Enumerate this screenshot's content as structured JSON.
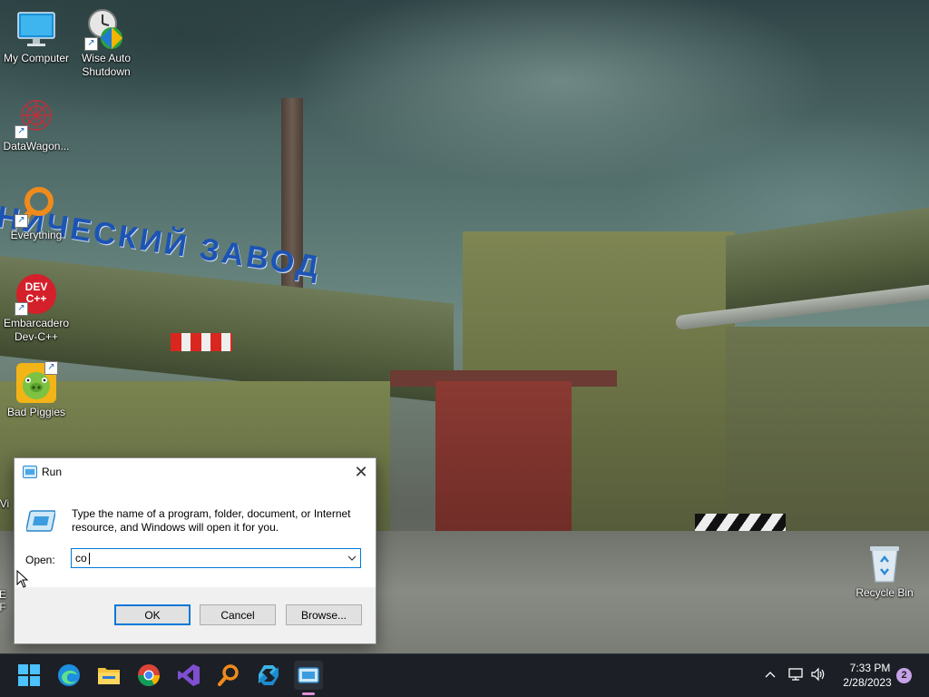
{
  "desktop": {
    "wallpaper_sign_text": "НИЧЕСКИЙ ЗАВОД",
    "icons": [
      {
        "label": "My Computer"
      },
      {
        "label": "Wise Auto Shutdown"
      },
      {
        "label": "DataWagon..."
      },
      {
        "label": "Everything"
      },
      {
        "label": "Embarcadero Dev-C++"
      },
      {
        "label": "Bad Piggies"
      },
      {
        "label": "Recycle Bin"
      }
    ],
    "devcpp_logo_text": "DEV C++",
    "partial_left_labels": [
      "Vi",
      "E",
      "F"
    ]
  },
  "run_dialog": {
    "title": "Run",
    "close_glyph": "✕",
    "description": "Type the name of a program, folder, document, or Internet resource, and Windows will open it for you.",
    "open_label": "Open:",
    "open_value": "co",
    "buttons": {
      "ok": "OK",
      "cancel": "Cancel",
      "browse": "Browse..."
    }
  },
  "taskbar": {
    "apps": [
      {
        "icon": "windows-start-icon"
      },
      {
        "icon": "edge-icon"
      },
      {
        "icon": "file-explorer-icon"
      },
      {
        "icon": "chrome-icon"
      },
      {
        "icon": "visual-studio-icon"
      },
      {
        "icon": "everything-search-icon"
      },
      {
        "icon": "app-icon"
      },
      {
        "icon": "run-icon",
        "active": true
      }
    ],
    "tray": {
      "time": "7:33 PM",
      "date": "2/28/2023",
      "notification_count": "2"
    }
  },
  "colors": {
    "taskbar_bg": "#1c2026",
    "accent": "#0078d7",
    "notification_badge": "#c7a2e6"
  }
}
